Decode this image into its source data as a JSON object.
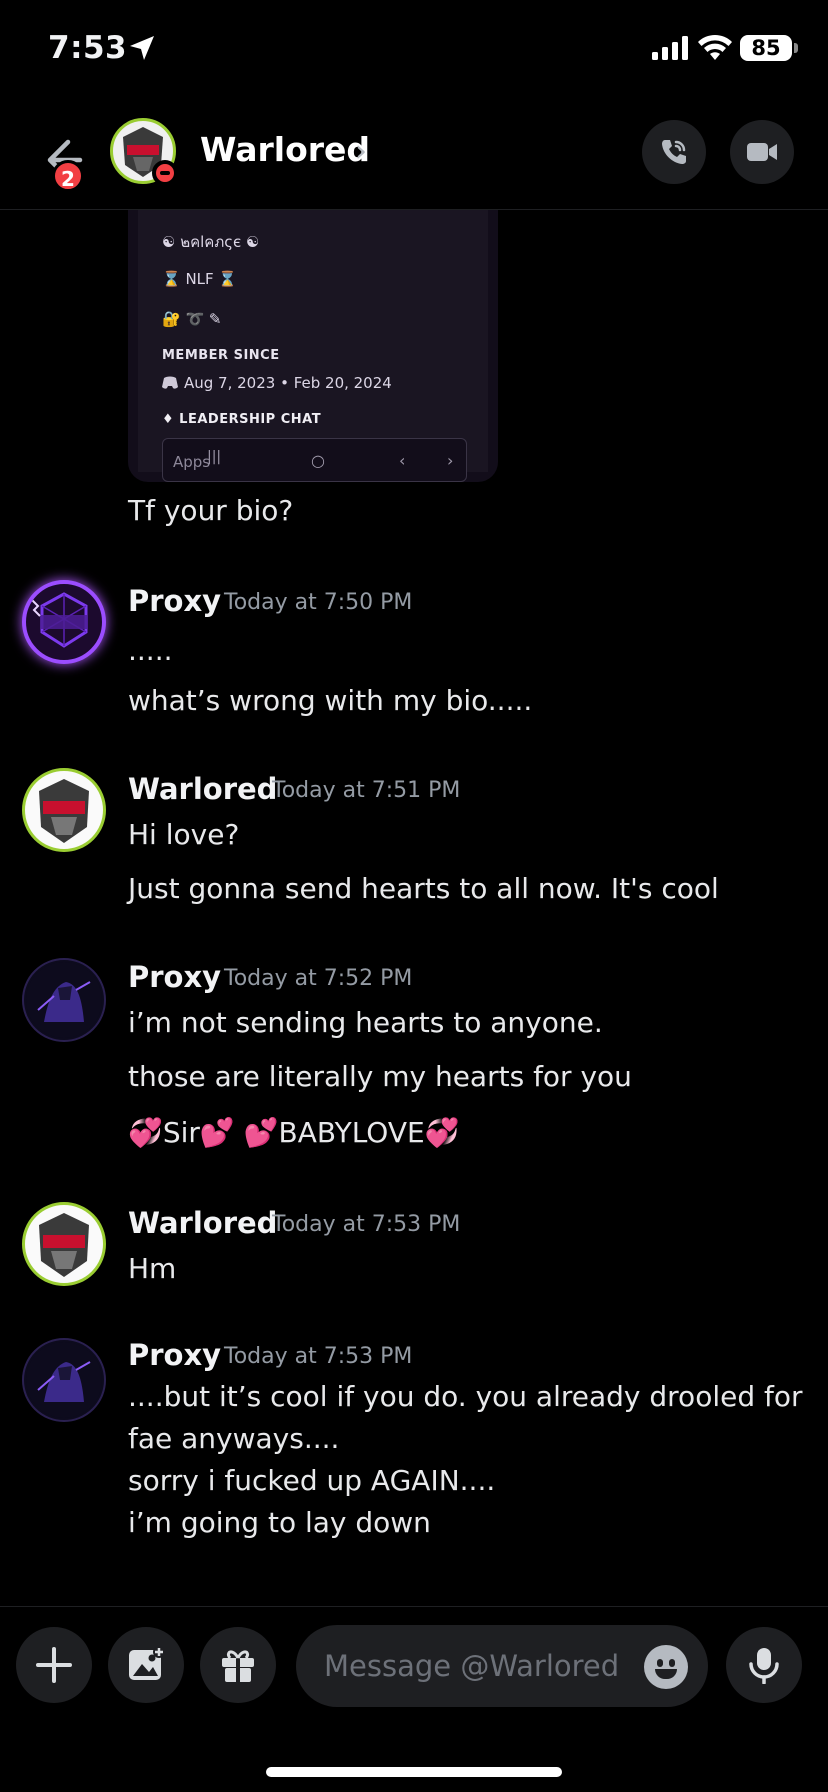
{
  "status_bar": {
    "time": "7:53",
    "battery": "85"
  },
  "header": {
    "back_badge": "2",
    "name": "Warlored",
    "chevron": "›"
  },
  "shared_screenshot": {
    "line1": "☯ ๒คlคภςє ☯",
    "line2": "⌛ NLF ⌛",
    "line3": "🔐 ➰ ✎",
    "member_since_heading": "MEMBER SINCE",
    "member_since_dates": "Aug 7, 2023  •  Feb 20, 2024",
    "leadership_chat": "♦ LEADERSHIP CHAT",
    "apps_label": "Apps",
    "nav_recent": "|||",
    "nav_home": "○",
    "nav_back": "‹",
    "nav_forward": "›"
  },
  "messages": [
    {
      "text": "Tf your bio?"
    },
    {
      "author": "Proxy",
      "time": "Today at 7:50 PM",
      "lines": [
        ".....",
        "what’s wrong with my bio....."
      ]
    },
    {
      "author": "Warlored",
      "time": "Today at 7:51 PM",
      "lines": [
        "Hi love?",
        "Just gonna send hearts to all now. It's cool"
      ]
    },
    {
      "author": "Proxy",
      "time": "Today at 7:52 PM",
      "lines": [
        "i’m not sending hearts to anyone.",
        "those are literally my hearts for you",
        "💞Sir💕  💕BABYLOVE💞"
      ]
    },
    {
      "author": "Warlored",
      "time": "Today at 7:53 PM",
      "lines": [
        "Hm"
      ]
    },
    {
      "author": "Proxy",
      "time": "Today at 7:53 PM",
      "lines": [
        "....but it’s cool if you do.  you already drooled for",
        "fae anyways....",
        "sorry i fucked up AGAIN....",
        "i’m going to lay down"
      ]
    }
  ],
  "composer": {
    "placeholder": "Message @Warlored"
  },
  "colors": {
    "background": "#000000",
    "surface": "#1e1f22",
    "timestamp": "#949ba4",
    "badge": "#f23f43",
    "status_ring": "#9acd32"
  }
}
